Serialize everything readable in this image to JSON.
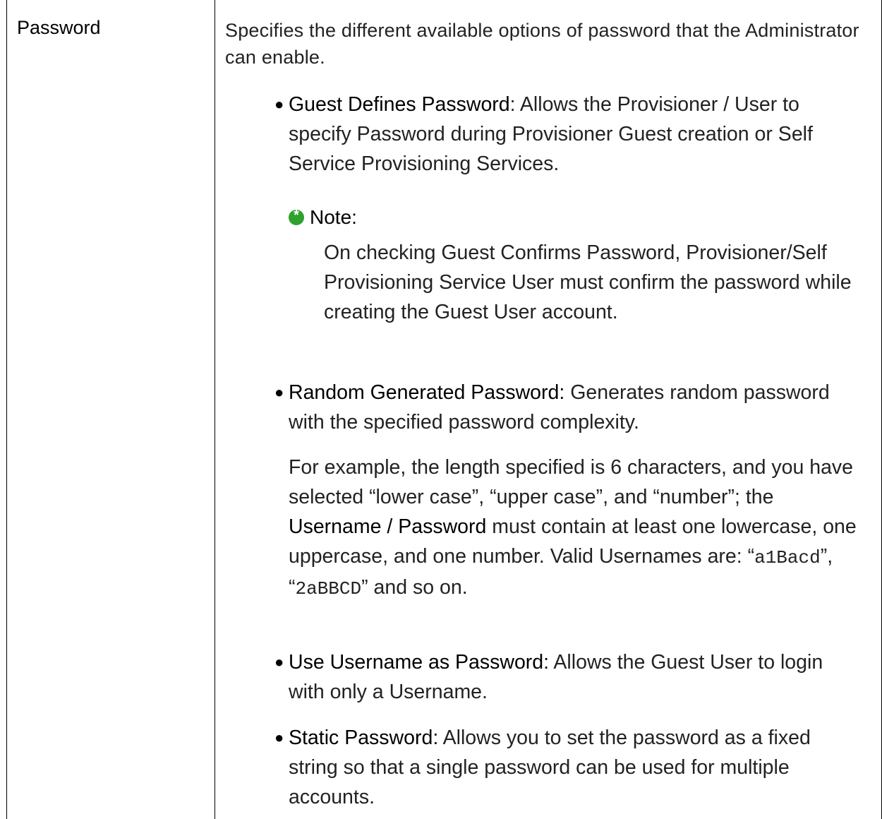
{
  "term": "Password",
  "intro": "Specifies the different available options of password that the Administrator can enable.",
  "items": [
    {
      "label": "Guest Defines Password",
      "sep": ": ",
      "text": "Allows the Provisioner / User to specify Password during Provisioner Guest creation or Self Service Provisioning Services."
    },
    {
      "label": "Random Generated Password:",
      "sep": " ",
      "text": "Generates random password with the specified password complexity."
    },
    {
      "label": "Use Username as Password:",
      "sep": " ",
      "text": "Allows the Guest User to login with only a Username."
    },
    {
      "label": "Static Password:",
      "sep": " ",
      "text": "Allows you to set the password as a fixed string so that a single password can be used for multiple accounts."
    }
  ],
  "note": {
    "heading": "Note:",
    "body": "On checking Guest Confirms Password, Provisioner/Self Provisioning Service User must confirm the password while creating the Guest User account.",
    "icon": "note-star-icon",
    "icon_color": "#2fa12f"
  },
  "example": {
    "part1": "For example, the length specified is 6 characters, and you have selected “lower case”, “upper case”, and “number”; the ",
    "bold": "Username / Password",
    "part2": " must contain at least one lowercase, one uppercase, and one number. Valid Usernames are: “",
    "code1": "a1Bacd",
    "part3": "”, “",
    "code2": "2aBBCD",
    "part4": "” and so on."
  }
}
